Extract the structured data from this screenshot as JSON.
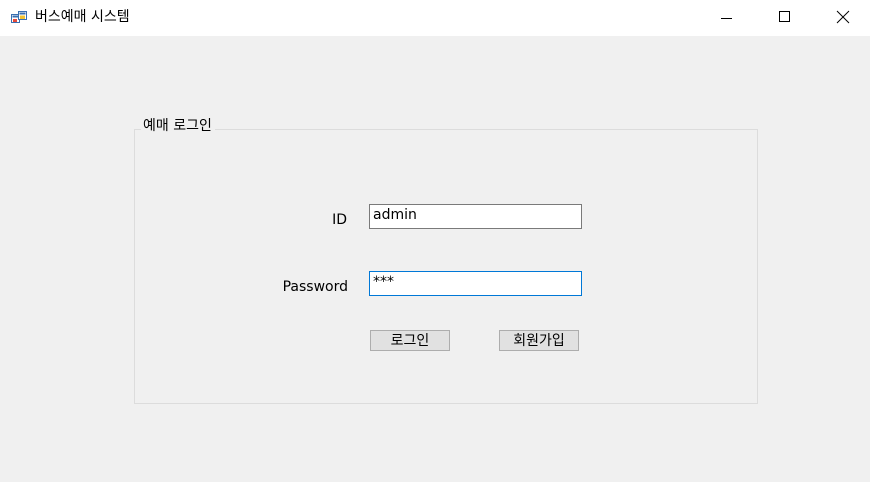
{
  "window": {
    "title": "버스예매 시스템",
    "icon": "windows-form-icon",
    "controls": {
      "minimize_icon": "minimize-icon",
      "maximize_icon": "maximize-icon",
      "close_icon": "close-icon"
    }
  },
  "login_group": {
    "title": "예매 로그인",
    "id_label": "ID",
    "id_value": "admin",
    "password_label": "Password",
    "password_value": "***",
    "login_button": "로그인",
    "signup_button": "회원가입"
  },
  "colors": {
    "background": "#f0f0f0",
    "titlebar": "#ffffff",
    "focus_border": "#0078d7",
    "button_face": "#e1e1e1"
  }
}
